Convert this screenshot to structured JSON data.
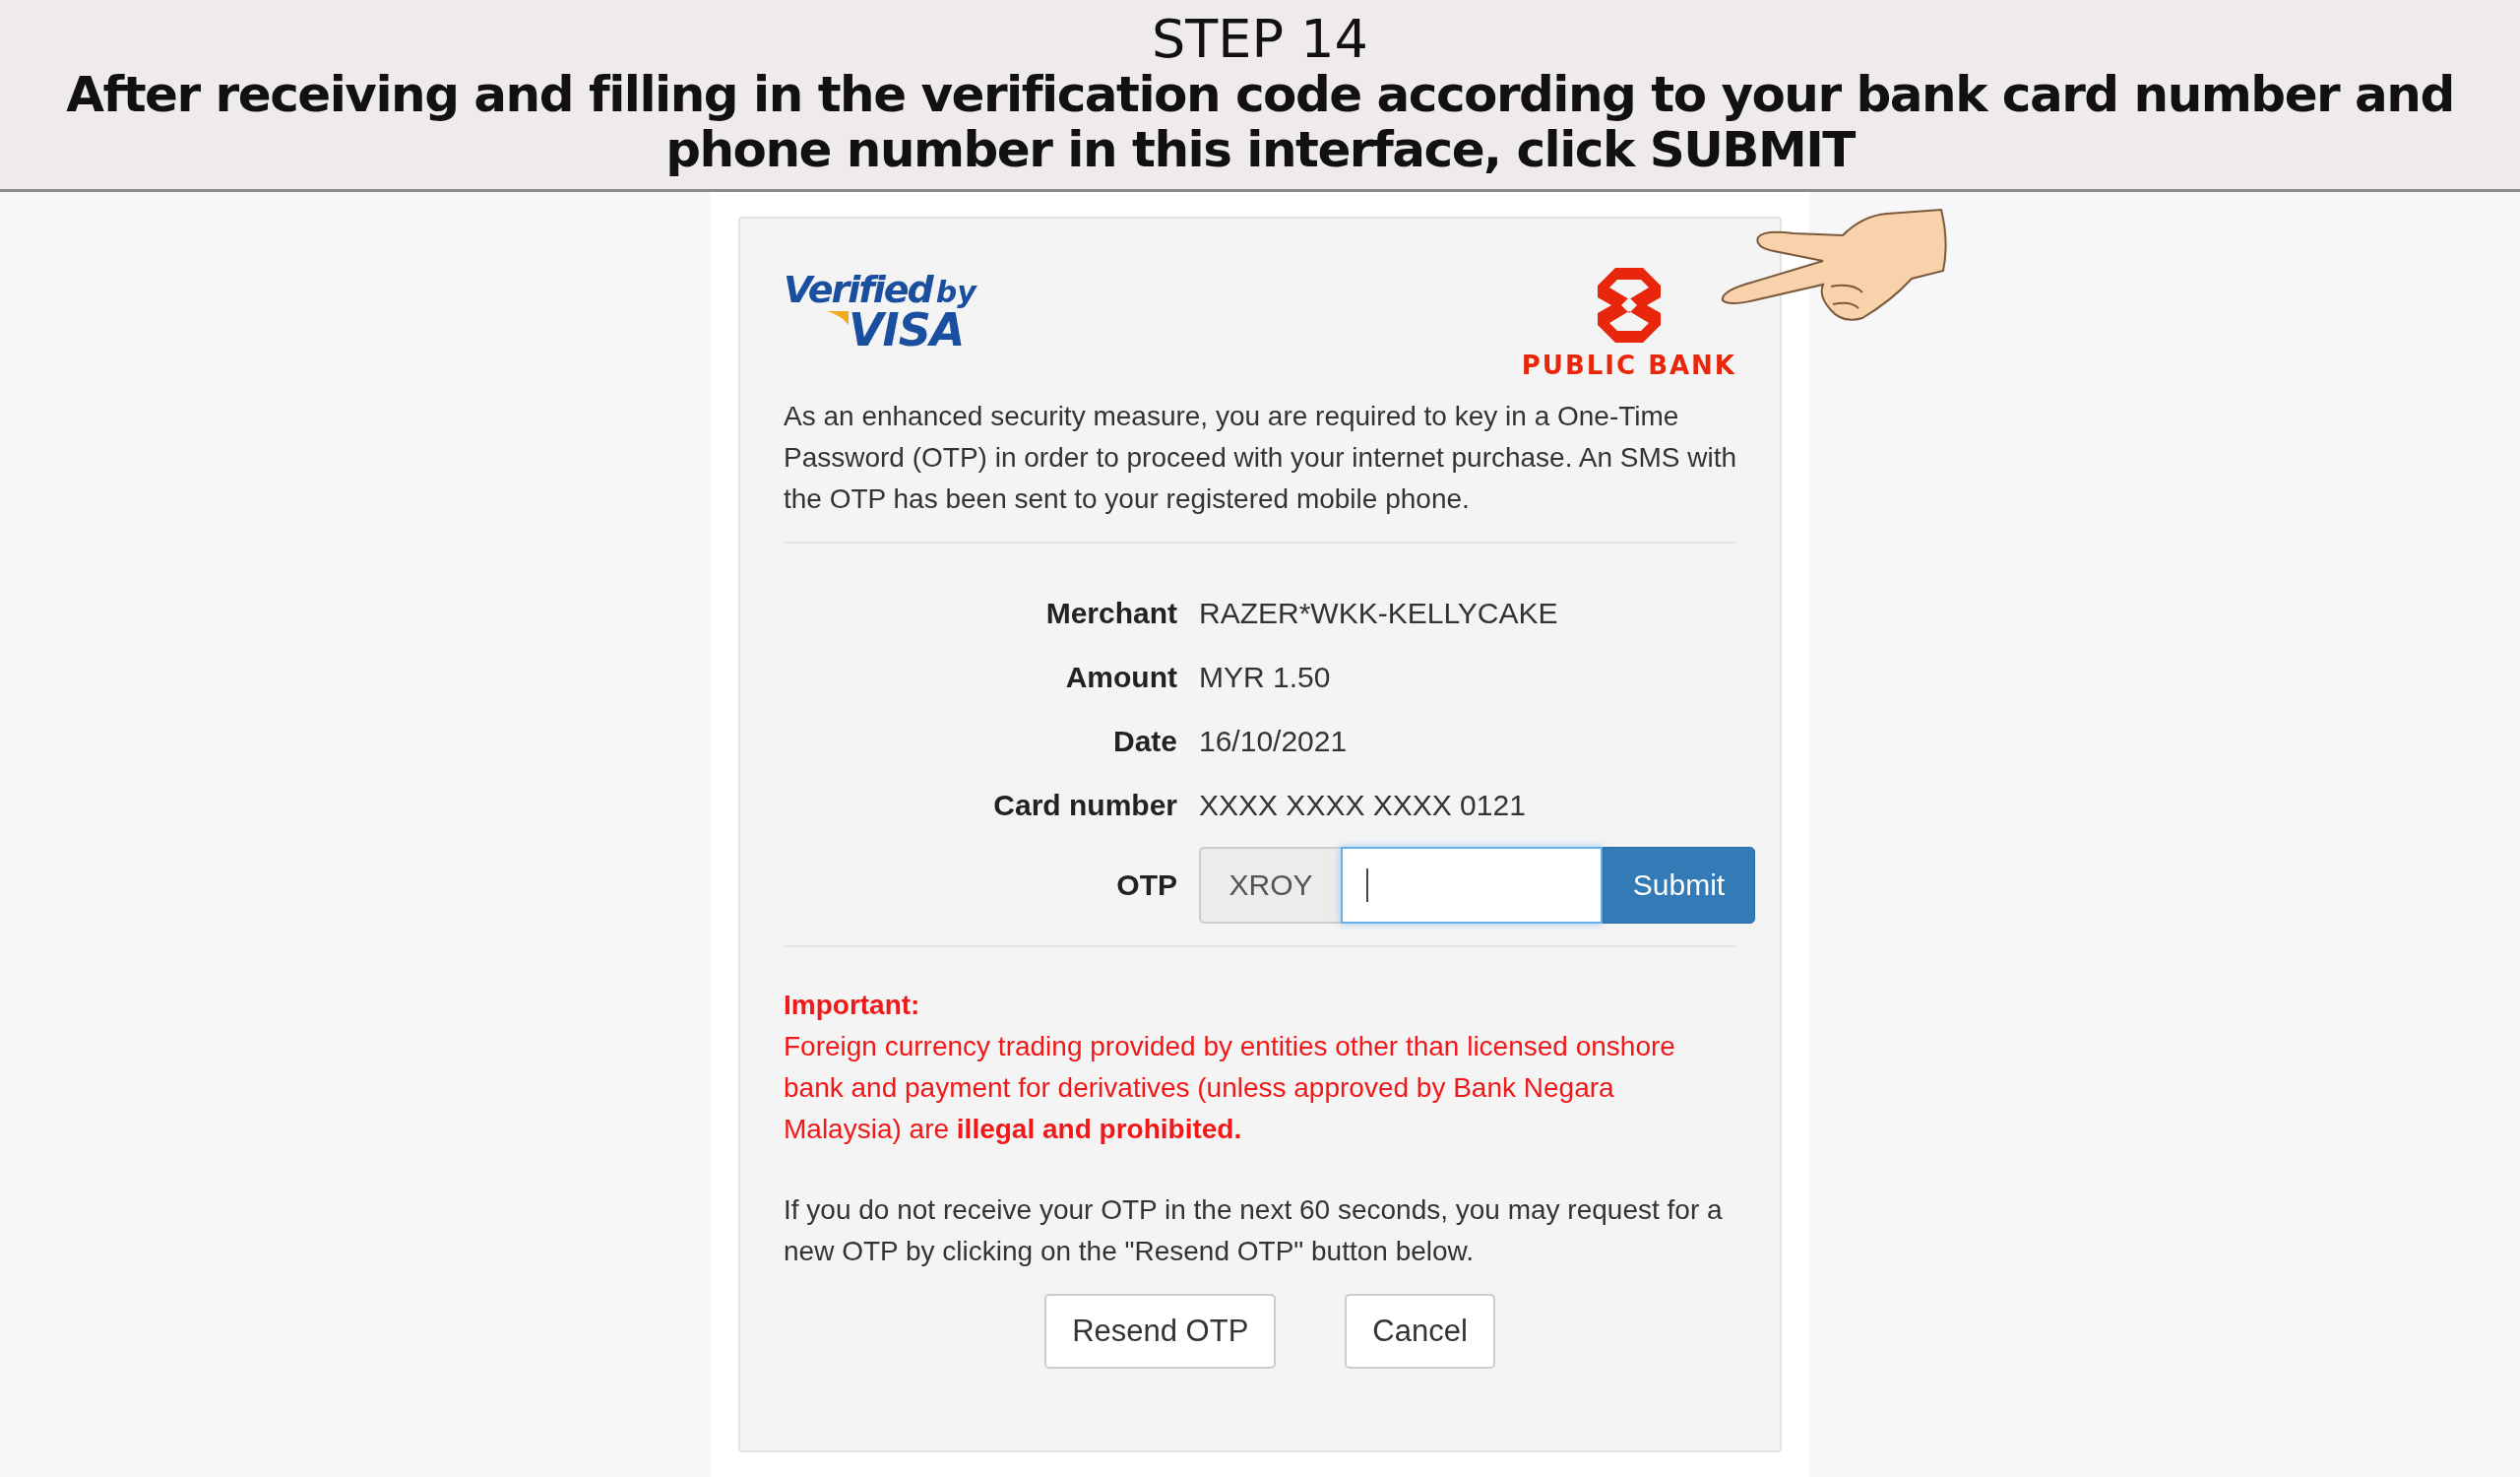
{
  "instruction": {
    "step": "STEP 14",
    "text": "After receiving and filling in the verification code according to your bank card number and phone number in this interface, click SUBMIT"
  },
  "card": {
    "visa_logo": {
      "verified": "Verified",
      "by": "by",
      "brand": "VISA"
    },
    "bank_logo": {
      "name": "PUBLIC BANK"
    },
    "intro": "As an enhanced security measure, you are required to key in a One-Time Password (OTP) in order to proceed with your internet purchase. An SMS with the OTP has been sent to your registered mobile phone.",
    "details": [
      {
        "label": "Merchant",
        "value": "RAZER*WKK-KELLYCAKE"
      },
      {
        "label": "Amount",
        "value": "MYR 1.50"
      },
      {
        "label": "Date",
        "value": "16/10/2021"
      },
      {
        "label": "Card number",
        "value": "XXXX XXXX XXXX 0121"
      }
    ],
    "otp": {
      "label": "OTP",
      "prefix": "XROY",
      "focused": true,
      "submit": "Submit"
    },
    "important": {
      "heading": "Important:",
      "text": "Foreign currency trading provided by entities other than licensed onshore bank and payment for derivatives (unless approved by Bank Negara Malaysia) are **illegal and prohibited.**"
    },
    "note": "If you do not receive your OTP in the next 60 seconds, you may request for a new OTP by clicking on the \"Resend OTP\" button below.",
    "buttons": [
      "Resend OTP",
      "Cancel"
    ]
  }
}
